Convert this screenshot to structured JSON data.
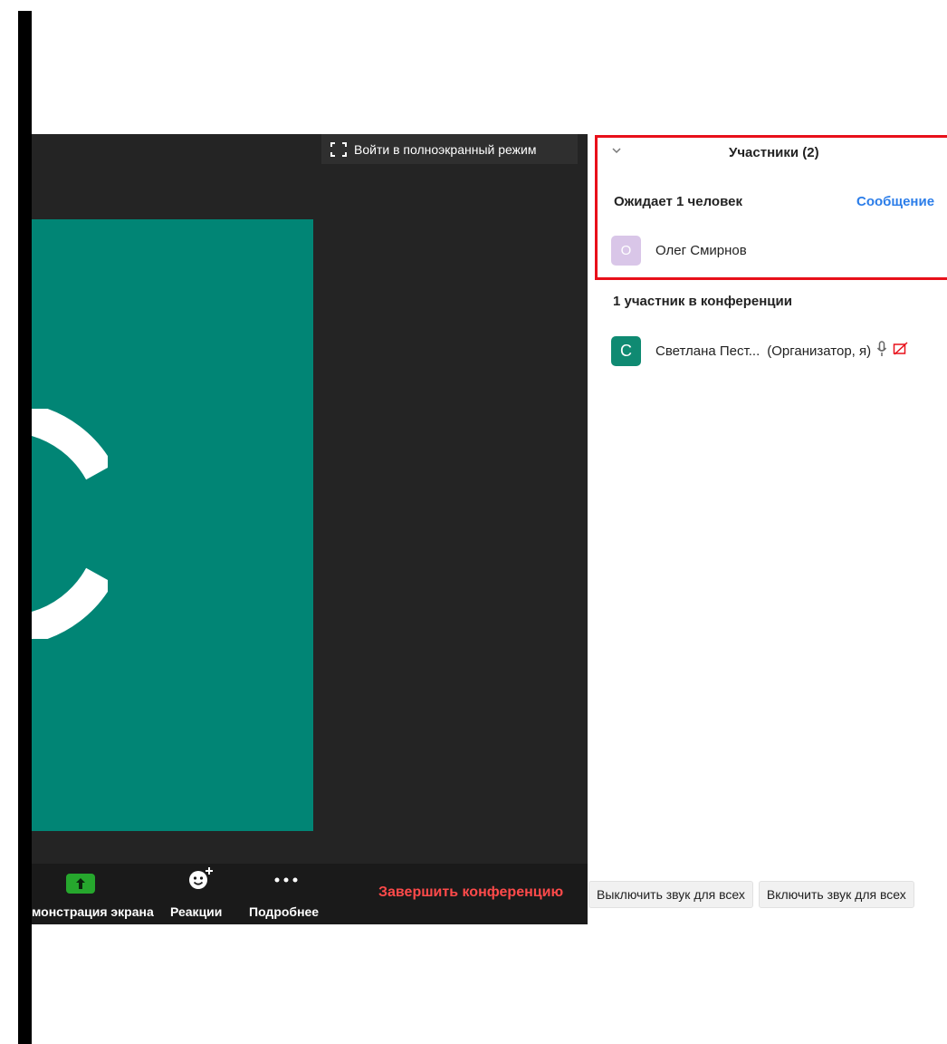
{
  "video": {
    "fullscreen_label": "Войти в полноэкранный режим",
    "avatar_letter": "C"
  },
  "toolbar": {
    "share_label": "монстрация экрана",
    "reactions_label": "Реакции",
    "more_label": "Подробнее",
    "end_label": "Завершить конференцию"
  },
  "panel": {
    "title": "Участники (2)",
    "waiting_label": "Ожидает 1 человек",
    "message_label": "Сообщение",
    "waiting_people": [
      {
        "initial": "О",
        "name": "Олег Смирнов"
      }
    ],
    "in_conference_label": "1 участник в конференции",
    "participants": [
      {
        "initial": "С",
        "name": "Светлана Пест...",
        "role": "(Организатор, я)"
      }
    ],
    "footer": {
      "mute_all": "Выключить звук для всех",
      "unmute_all": "Включить звук для всех"
    }
  },
  "colors": {
    "accent": "#2b7de9",
    "highlight_border": "#e8101a",
    "tile_bg": "#018575",
    "end_red": "#ff4a4a"
  }
}
